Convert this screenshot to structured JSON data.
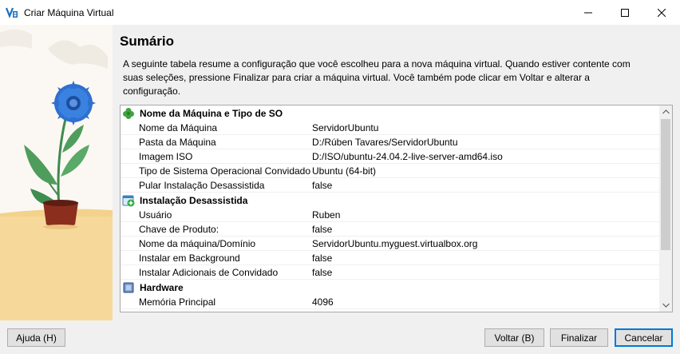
{
  "window": {
    "title": "Criar Máquina Virtual",
    "icon": "virtualbox-icon",
    "controls": [
      "minimize-icon",
      "maximize-icon",
      "close-icon"
    ]
  },
  "page": {
    "heading": "Sumário",
    "description": "A seguinte tabela resume a configuração que você escolheu para a nova máquina virtual. Quando estiver contente com suas seleções, pressione Finalizar para criar a máquina virtual. Você também pode clicar em Voltar e alterar a configuração."
  },
  "summary": {
    "section1": {
      "title": "Nome da Máquina e Tipo de SO",
      "icon": "clover-icon",
      "rows": [
        {
          "key": "Nome da Máquina",
          "value": "ServidorUbuntu"
        },
        {
          "key": "Pasta da Máquina",
          "value": "D:/Rúben Tavares/ServidorUbuntu"
        },
        {
          "key": "Imagem ISO",
          "value": "D:/ISO/ubuntu-24.04.2-live-server-amd64.iso"
        },
        {
          "key": "Tipo de Sistema Operacional Convidado",
          "value": "Ubuntu (64-bit)"
        },
        {
          "key": "Pular Instalação Desassistida",
          "value": "false"
        }
      ]
    },
    "section2": {
      "title": "Instalação Desassistida",
      "icon": "unattended-install-icon",
      "rows": [
        {
          "key": "Usuário",
          "value": "Ruben"
        },
        {
          "key": "Chave de Produto:",
          "value": "false"
        },
        {
          "key": "Nome da máquina/Domínio",
          "value": "ServidorUbuntu.myguest.virtualbox.org"
        },
        {
          "key": "Instalar em Background",
          "value": "false"
        },
        {
          "key": "Instalar Adicionais de Convidado",
          "value": "false"
        }
      ]
    },
    "section3": {
      "title": "Hardware",
      "icon": "chip-icon",
      "rows": [
        {
          "key": "Memória Principal",
          "value": "4096"
        }
      ]
    }
  },
  "buttons": {
    "help": "Ajuda (H)",
    "back": "Voltar (B)",
    "finish": "Finalizar",
    "cancel": "Cancelar"
  },
  "colors": {
    "accent": "#0078d7",
    "panel_bg": "#f0f0f0"
  }
}
